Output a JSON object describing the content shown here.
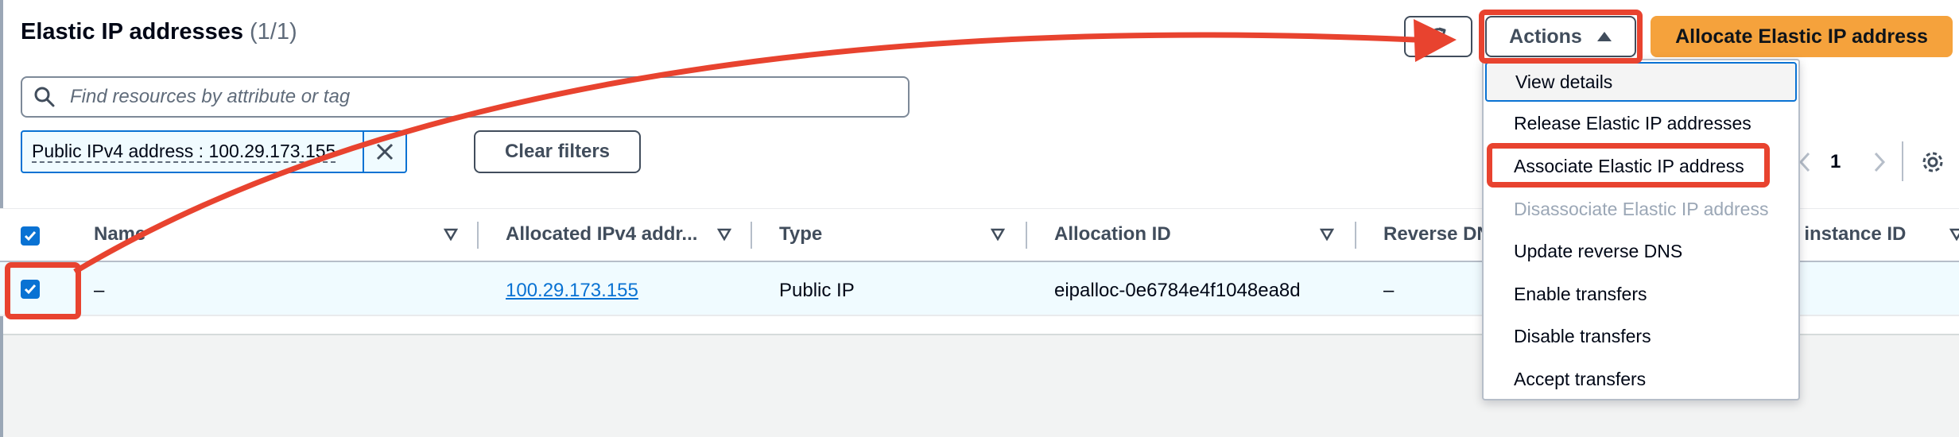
{
  "header": {
    "title": "Elastic IP addresses",
    "count": "(1/1)",
    "refresh_icon": "refresh-icon",
    "actions_label": "Actions",
    "actions_caret_icon": "caret-up-icon",
    "allocate_label": "Allocate Elastic IP address"
  },
  "search": {
    "placeholder": "Find resources by attribute or tag",
    "value": "",
    "icon": "search-icon"
  },
  "filter": {
    "token_label": "Public IPv4 address : 100.29.173.155",
    "dismiss_icon": "close-icon",
    "clear_label": "Clear filters"
  },
  "pagination": {
    "prev_icon": "chevron-left-icon",
    "page": "1",
    "next_icon": "chevron-right-icon",
    "settings_icon": "gear-icon"
  },
  "table": {
    "columns": [
      "Name",
      "Allocated IPv4 addr...",
      "Type",
      "Allocation ID",
      "Reverse DNS",
      "d instance ID"
    ],
    "rows": [
      {
        "selected": true,
        "name": "–",
        "ipv4": "100.29.173.155",
        "type": "Public IP",
        "allocation_id": "eipalloc-0e6784e4f1048ea8d",
        "reverse_dns": "–"
      }
    ]
  },
  "actions_menu": {
    "items": [
      {
        "label": "View details",
        "disabled": false
      },
      {
        "label": "Release Elastic IP addresses",
        "disabled": false
      },
      {
        "label": "Associate Elastic IP address",
        "disabled": false
      },
      {
        "label": "Disassociate Elastic IP address",
        "disabled": true
      },
      {
        "label": "Update reverse DNS",
        "disabled": false
      },
      {
        "label": "Enable transfers",
        "disabled": false
      },
      {
        "label": "Disable transfers",
        "disabled": false
      },
      {
        "label": "Accept transfers",
        "disabled": false
      }
    ]
  },
  "colors": {
    "primary_button": "#f5a23c",
    "link": "#0972d3",
    "annotation": "#e8432f",
    "selected_row": "#f0fbff"
  }
}
